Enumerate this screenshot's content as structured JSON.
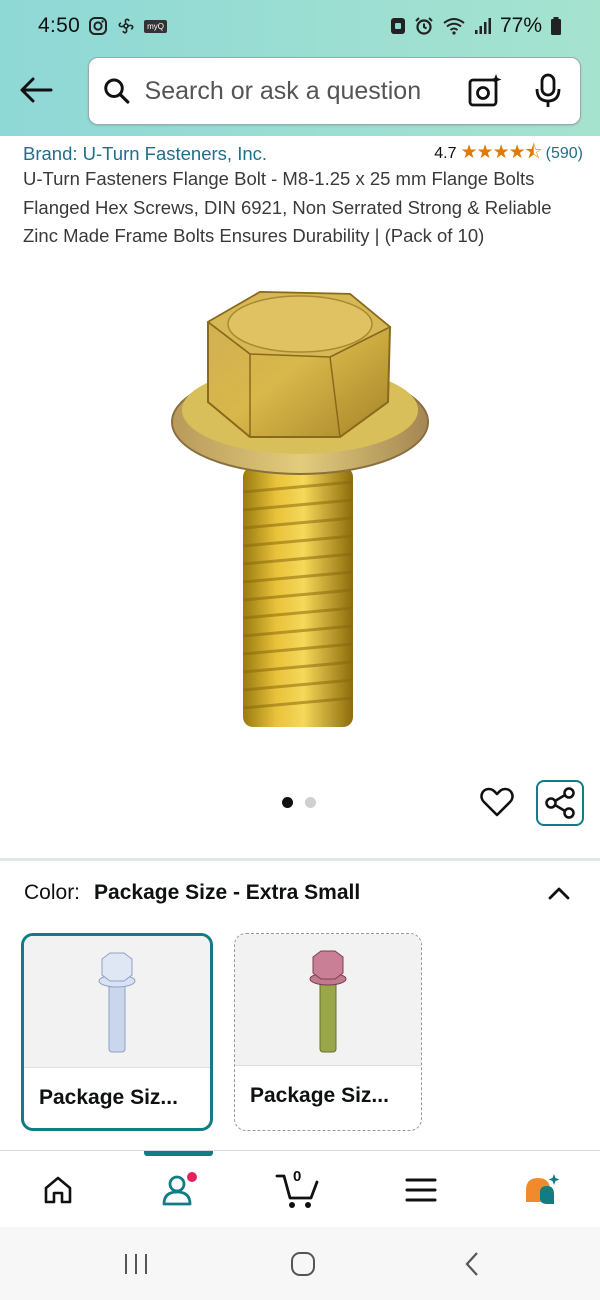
{
  "status_bar": {
    "time": "4:50",
    "battery": "77%",
    "app_badge": "myQ"
  },
  "header": {
    "search_placeholder": "Search or ask a question"
  },
  "product": {
    "brand": "Brand: U-Turn Fasteners, Inc.",
    "rating": "4.7",
    "stars": "★★★★⯪",
    "review_count": "(590)",
    "title": "U-Turn Fasteners Flange Bolt - M8-1.25 x 25 mm Flange Bolts Flanged Hex Screws, DIN 6921, Non Serrated Strong & Reliable Zinc Made Frame Bolts Ensures Durability | (Pack of 10)",
    "image_count": 2,
    "image_index": 1
  },
  "variation": {
    "label": "Color:",
    "value": "Package Size - Extra Small",
    "options": [
      {
        "label": "Package Siz...",
        "selected": true,
        "color": "silver"
      },
      {
        "label": "Package Siz...",
        "selected": false,
        "color": "yellow-magenta"
      }
    ]
  },
  "bottom_nav": {
    "items": [
      "home-icon",
      "account-icon",
      "cart-icon",
      "menu-icon",
      "rufus-icon"
    ],
    "cart_count": "0",
    "active_index": 1
  },
  "colors": {
    "accent": "#127c84",
    "header_bg": "#8ed8d6",
    "link": "#1f6f8b",
    "star": "#e07b00"
  }
}
